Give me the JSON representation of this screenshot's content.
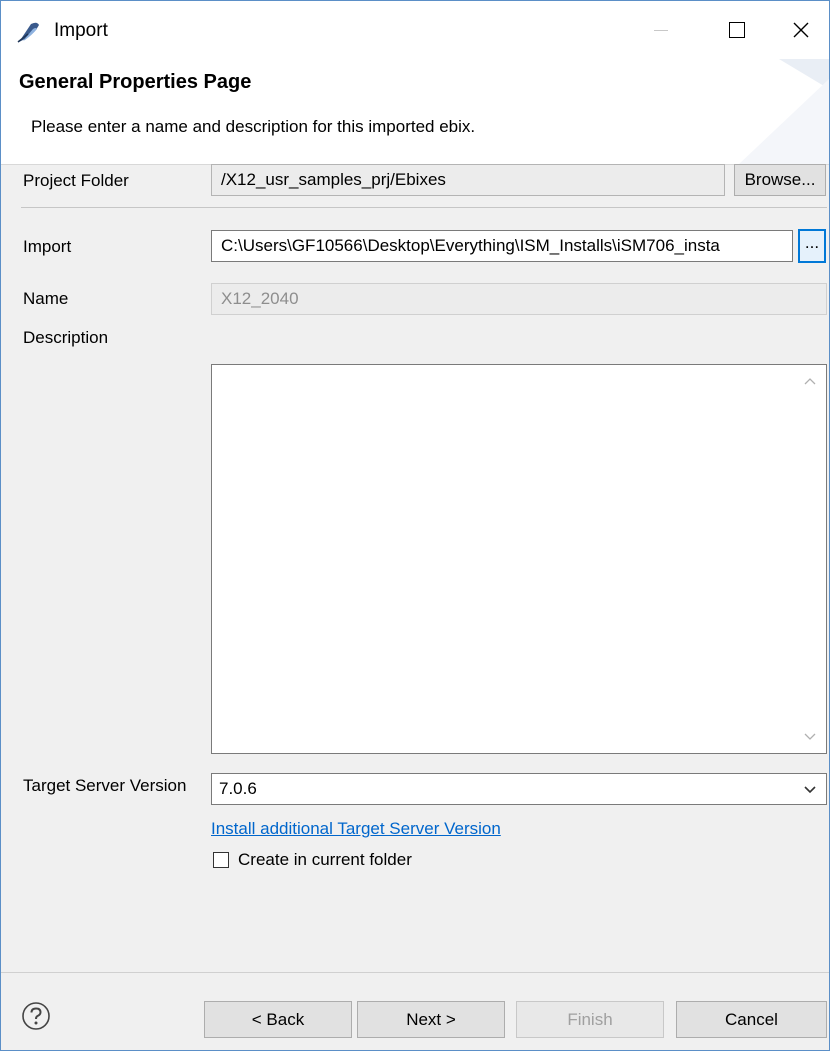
{
  "window": {
    "title": "Import"
  },
  "header": {
    "title": "General Properties Page",
    "description": "Please enter a name and description for this imported ebix."
  },
  "form": {
    "project_folder_label": "Project Folder",
    "project_folder_value": "/X12_usr_samples_prj/Ebixes",
    "browse_label": "Browse...",
    "import_label": "Import",
    "import_value": "C:\\Users\\GF10566\\Desktop\\Everything\\ISM_Installs\\iSM706_insta",
    "import_browse_label": "...",
    "name_label": "Name",
    "name_value": "X12_2040",
    "description_label": "Description",
    "description_value": "",
    "target_server_label": "Target Server Version",
    "target_server_value": "7.0.6",
    "install_link": "Install additional Target Server Version",
    "create_in_folder_label": "Create in current folder",
    "create_in_folder_checked": false
  },
  "footer": {
    "back_label": "< Back",
    "next_label": "Next >",
    "finish_label": "Finish",
    "cancel_label": "Cancel"
  },
  "colors": {
    "link": "#0066cc",
    "focus": "#0078d7",
    "window_border": "#5b8fc7"
  }
}
